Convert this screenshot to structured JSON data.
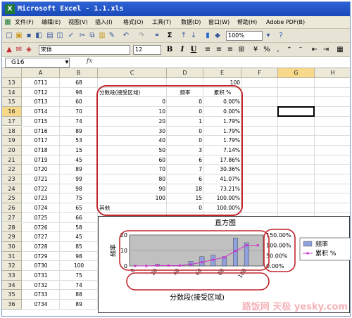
{
  "window": {
    "title": "Microsoft Excel - 1.1.xls"
  },
  "menubar": {
    "items": [
      "文件(F)",
      "编辑(E)",
      "视图(V)",
      "插入(I)",
      "格式(O)",
      "工具(T)",
      "数据(D)",
      "窗口(W)",
      "帮助(H)",
      "Adobe PDF(B)"
    ]
  },
  "toolbar": {
    "zoom": "100%",
    "font_name": "宋体",
    "font_size": "12",
    "bold": "B",
    "italic": "I",
    "underline": "U",
    "percent": "%",
    "sum": "Σ"
  },
  "formula_bar": {
    "name_box": "G16",
    "fx": "fx",
    "content": ""
  },
  "sheet": {
    "columns": [
      "A",
      "B",
      "C",
      "D",
      "E",
      "F",
      "G",
      "H"
    ],
    "selected_column": "G",
    "selected_row": "16",
    "rows": [
      {
        "n": "13",
        "A": "0711",
        "B": "68",
        "C": "",
        "D": "",
        "E": "100"
      },
      {
        "n": "14",
        "A": "0712",
        "B": "98",
        "C": "分数段(接受区域)",
        "D": "频率",
        "E": "累积 %"
      },
      {
        "n": "15",
        "A": "0713",
        "B": "60",
        "C": "0",
        "D": "0",
        "E": "0.00%"
      },
      {
        "n": "16",
        "A": "0714",
        "B": "70",
        "C": "10",
        "D": "0",
        "E": "0.00%"
      },
      {
        "n": "17",
        "A": "0715",
        "B": "74",
        "C": "20",
        "D": "1",
        "E": "1.79%"
      },
      {
        "n": "18",
        "A": "0716",
        "B": "89",
        "C": "30",
        "D": "0",
        "E": "1.79%"
      },
      {
        "n": "19",
        "A": "0717",
        "B": "53",
        "C": "40",
        "D": "0",
        "E": "1.79%"
      },
      {
        "n": "20",
        "A": "0718",
        "B": "15",
        "C": "50",
        "D": "3",
        "E": "7.14%"
      },
      {
        "n": "21",
        "A": "0719",
        "B": "45",
        "C": "60",
        "D": "6",
        "E": "17.86%"
      },
      {
        "n": "22",
        "A": "0720",
        "B": "89",
        "C": "70",
        "D": "7",
        "E": "30.36%"
      },
      {
        "n": "23",
        "A": "0721",
        "B": "99",
        "C": "80",
        "D": "6",
        "E": "41.07%"
      },
      {
        "n": "24",
        "A": "0722",
        "B": "98",
        "C": "90",
        "D": "18",
        "E": "73.21%"
      },
      {
        "n": "25",
        "A": "0723",
        "B": "75",
        "C": "100",
        "D": "15",
        "E": "100.00%"
      },
      {
        "n": "26",
        "A": "0724",
        "B": "65",
        "C": "其他",
        "D": "0",
        "E": "100.00%"
      },
      {
        "n": "27",
        "A": "0725",
        "B": "66",
        "C": "",
        "D": "",
        "E": ""
      },
      {
        "n": "28",
        "A": "0726",
        "B": "58",
        "C": "",
        "D": "",
        "E": ""
      },
      {
        "n": "29",
        "A": "0727",
        "B": "45",
        "C": "",
        "D": "",
        "E": ""
      },
      {
        "n": "30",
        "A": "0728",
        "B": "85",
        "C": "",
        "D": "",
        "E": ""
      },
      {
        "n": "31",
        "A": "0729",
        "B": "98",
        "C": "",
        "D": "",
        "E": ""
      },
      {
        "n": "32",
        "A": "0730",
        "B": "100",
        "C": "",
        "D": "",
        "E": ""
      },
      {
        "n": "33",
        "A": "0731",
        "B": "75",
        "C": "",
        "D": "",
        "E": ""
      },
      {
        "n": "34",
        "A": "0732",
        "B": "74",
        "C": "",
        "D": "",
        "E": ""
      },
      {
        "n": "35",
        "A": "0733",
        "B": "88",
        "C": "",
        "D": "",
        "E": ""
      },
      {
        "n": "36",
        "A": "0734",
        "B": "89",
        "C": "",
        "D": "",
        "E": ""
      }
    ]
  },
  "chart_data": {
    "type": "bar",
    "title": "直方图",
    "xlabel": "分数段(接受区域)",
    "ylabel": "频率",
    "categories": [
      "0",
      "10",
      "20",
      "30",
      "40",
      "50",
      "60",
      "70",
      "80",
      "90",
      "100",
      "其他"
    ],
    "x_tick_labels": [
      "0",
      "20",
      "40",
      "60",
      "80",
      "100"
    ],
    "ylim": [
      0,
      20
    ],
    "y_ticks": [
      "0",
      "10",
      "20"
    ],
    "y2_ticks": [
      "0.00%",
      "50.00%",
      "100.00%",
      "150.00%"
    ],
    "series": [
      {
        "name": "频率",
        "kind": "bar",
        "color": "#8fa0dc",
        "values": [
          0,
          0,
          1,
          0,
          0,
          3,
          6,
          7,
          6,
          18,
          15,
          0
        ]
      },
      {
        "name": "累积 %",
        "kind": "line",
        "color": "#cc33cc",
        "values": [
          0,
          0,
          1.79,
          1.79,
          1.79,
          7.14,
          17.86,
          30.36,
          41.07,
          73.21,
          100,
          100
        ]
      }
    ],
    "legend": "right"
  },
  "watermark": {
    "text": "路饭网 天极 yesky.com"
  },
  "colors": {
    "title_bar": "#1a49b8",
    "annotation_red": "#c1272d",
    "plot_bg": "#c0c0c0",
    "selected_header": "#f8d98a"
  }
}
